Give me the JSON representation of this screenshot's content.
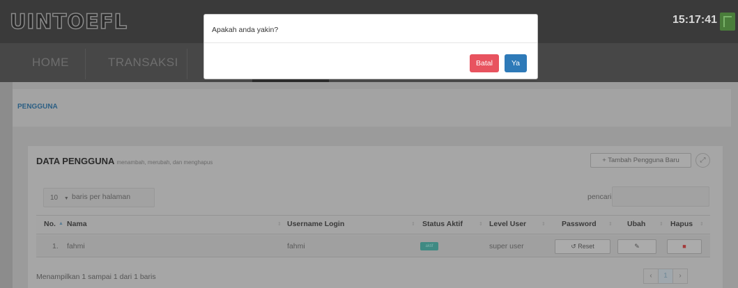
{
  "app": {
    "logo": "UINTOEFL",
    "clock": "15:17:41"
  },
  "nav": {
    "items": [
      "HOME",
      "TRANSAKSI"
    ]
  },
  "breadcrumb": "PENGGUNA",
  "panel": {
    "title": "DATA PENGGUNA",
    "subtitle": "menambah, merubah, dan menghapus",
    "add_button": "+ Tambah Pengguna Baru"
  },
  "table_controls": {
    "page_length": "10",
    "page_length_label": "baris per halaman",
    "search_label": "pencarian:",
    "search_value": ""
  },
  "table": {
    "headers": [
      "No.",
      "Nama",
      "Username Login",
      "Status Aktif",
      "Level User",
      "Password",
      "Ubah",
      "Hapus"
    ],
    "rows": [
      {
        "no": "1.",
        "nama": "fahmi",
        "username": "fahmi",
        "status": "aktif",
        "level": "super user",
        "reset_label": "Reset"
      }
    ],
    "info": "Menampilkan 1 sampai 1 dari 1 baris",
    "pagination": {
      "prev": "‹",
      "current": "1",
      "next": "›"
    }
  },
  "modal": {
    "message": "Apakah anda yakin?",
    "cancel_label": "Batal",
    "confirm_label": "Ya"
  },
  "colors": {
    "danger": "#e8535f",
    "primary": "#2e7ab8",
    "status_active": "#3f8a83"
  }
}
